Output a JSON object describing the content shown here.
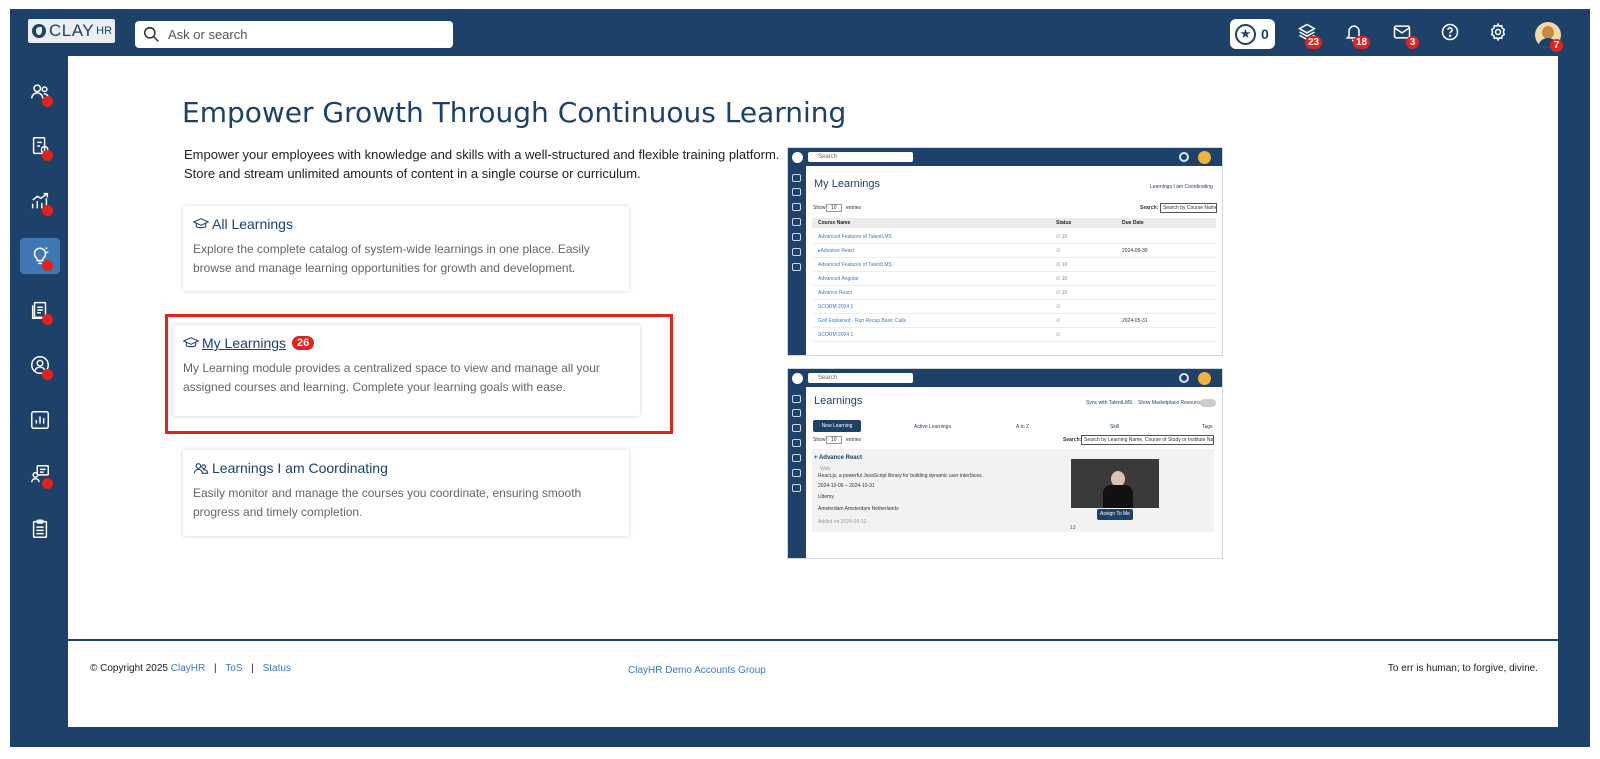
{
  "header": {
    "logo_text": "CLAY",
    "logo_suffix": "HR",
    "search_placeholder": "Ask or search",
    "stars_count": "0",
    "learning_badge": "23",
    "notifications_badge": "18",
    "messages_badge": "3",
    "avatar_badge": "7"
  },
  "hero": {
    "title": "Empower Growth Through Continuous Learning",
    "description": "Empower your employees with knowledge and skills with a well-structured and flexible training platform. Store and stream unlimited amounts of content in a single course or curriculum."
  },
  "cards": {
    "all_learnings": {
      "title": "All Learnings",
      "description": "Explore the complete catalog of system-wide learnings in one place. Easily browse and manage learning opportunities for growth and development."
    },
    "my_learnings": {
      "title": "My Learnings",
      "count": "26",
      "description": "My Learning module provides a centralized space to view and manage all your assigned courses and learning. Complete your learning goals with ease."
    },
    "coordinating": {
      "title": "Learnings I am Coordinating",
      "description": "Easily monitor and manage the courses you coordinate, ensuring smooth progress and timely completion."
    }
  },
  "preview_my_learnings": {
    "search": "Search",
    "title": "My Learnings",
    "coordinating_link": "Learnings I am Coordinating",
    "show_label": "Show",
    "entries_value": "10",
    "entries_label": "entries",
    "search_label": "Search:",
    "search_placeholder": "Search by Course Name",
    "columns": [
      "Course Name",
      "Status",
      "Due Date"
    ],
    "rows": [
      {
        "course": "Advanced Features of TalentLMS",
        "status": "∅ 10",
        "due": ""
      },
      {
        "course": "▸Advance React",
        "status": "∅",
        "due": "2024-09-30"
      },
      {
        "course": "Advanced Features of TalentLMS",
        "status": "∅ 10",
        "due": ""
      },
      {
        "course": "Advanced Angular",
        "status": "∅ 10",
        "due": ""
      },
      {
        "course": "Advance React",
        "status": "∅ 10",
        "due": ""
      },
      {
        "course": "SCORM 2004 1",
        "status": "∅",
        "due": ""
      },
      {
        "course": "Golf Explained - Run Recap Basic Calls",
        "status": "∅",
        "due": "2024-05-31"
      },
      {
        "course": "SCORM 2004 1",
        "status": "∅",
        "due": ""
      }
    ]
  },
  "preview_learnings": {
    "search": "Search",
    "title": "Learnings",
    "sync_label": "Sync with TalentLMS",
    "marketplace_label": "Show Marketplace Resources",
    "new_learning": "New Learning",
    "filter_active": "Active Learnings",
    "filter_sort": "A to Z",
    "filter_skill": "Skill",
    "tags_label": "Tags",
    "show_label": "Show",
    "entries_value": "10",
    "entries_label": "entries",
    "search_label": "Search:",
    "search_placeholder": "Search by Learning Name, Course of Study or Institute Name",
    "course_title": "+ Advance React",
    "course_type": "Web",
    "course_desc": "React.js, a powerful JavaScript library for building dynamic user interfaces.",
    "course_dates": "2024-10-06 – 2024-10-31",
    "course_provider": "Udemy",
    "course_location": "Amsterdam Amsterdam Netherlands",
    "course_added": "Added on 2024-09-12",
    "assign_button": "Assign To Me",
    "course_count": "13"
  },
  "footer": {
    "copyright": "© Copyright 2025",
    "brand": "ClayHR",
    "tos": "ToS",
    "status": "Status",
    "group": "ClayHR Demo Accounts Group",
    "quote": "To err is human; to forgive, divine."
  },
  "colors": {
    "navy": "#1d4168",
    "accent_blue": "#3d78b5",
    "badge_red": "#e2231a"
  }
}
